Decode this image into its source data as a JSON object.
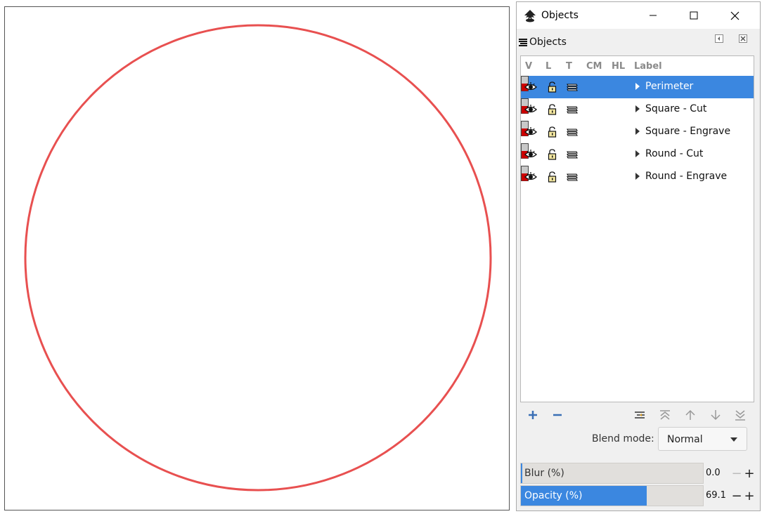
{
  "window": {
    "title": "Objects"
  },
  "panel": {
    "tab_label": "Objects"
  },
  "tree": {
    "columns": [
      "V",
      "L",
      "T",
      "CM",
      "HL",
      "Label"
    ],
    "rows": [
      {
        "label": "Perimeter",
        "selected": true,
        "highlight_color": "#cc0000"
      },
      {
        "label": "Square - Cut",
        "selected": false,
        "highlight_color": "#cc0000"
      },
      {
        "label": "Square - Engrave",
        "selected": false,
        "highlight_color": "#cc0000"
      },
      {
        "label": "Round - Cut",
        "selected": false,
        "highlight_color": "#cc0000"
      },
      {
        "label": "Round - Engrave",
        "selected": false,
        "highlight_color": "#cc0000"
      }
    ]
  },
  "toolbar": {
    "add_icon": "plus-icon",
    "remove_icon": "minus-icon",
    "icons": [
      "collapse-all-icon",
      "raise-to-top-icon",
      "raise-icon",
      "lower-icon",
      "lower-to-bottom-icon"
    ]
  },
  "blend": {
    "label": "Blend mode:",
    "value": "Normal"
  },
  "blur": {
    "label": "Blur (%)",
    "value": "0.0",
    "fraction": 0.0
  },
  "opacity": {
    "label": "Opacity (%)",
    "value": "69.1",
    "fraction": 0.691
  },
  "colors": {
    "selection": "#3b87e0",
    "circle_stroke": "#e85050"
  }
}
